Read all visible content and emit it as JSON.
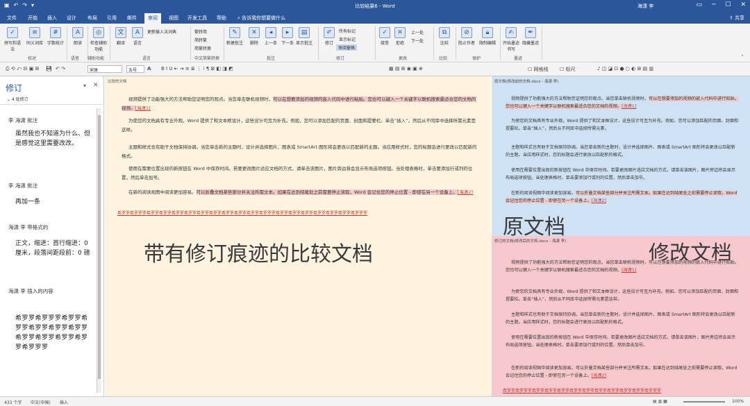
{
  "window": {
    "title": "比较结果6 - Word",
    "user": "海潇 李",
    "qa_icons": [
      "save-icon",
      "undo-icon",
      "redo-icon",
      "customize-icon"
    ]
  },
  "tabs": [
    "文件",
    "开始",
    "插入",
    "设计",
    "布局",
    "引用",
    "邮件",
    "审阅",
    "视图",
    "开发工具",
    "帮助"
  ],
  "active_tab": "审阅",
  "tell_me": "告诉我你想要做什么",
  "share": "共享",
  "ribbon": {
    "proof": [
      "拼写和语法",
      "同义词库",
      "字数统计"
    ],
    "proof_group": "校对",
    "speech": "朗读",
    "speech_group": "语音",
    "access": "检查辅助功能",
    "access_group": "辅助功能",
    "lang": [
      "翻译",
      "语言"
    ],
    "lang_group": "语言",
    "update_ime": "更新输入法词典",
    "chinese": [
      "繁转简",
      "简转繁",
      "简繁转换"
    ],
    "chinese_group": "中文简繁转换",
    "comments": [
      "新建批注",
      "删除",
      "上一条",
      "下一条",
      "显示批注"
    ],
    "comments_group": "批注",
    "track": [
      "修订",
      "所有标记",
      "显示标记",
      "审阅窗格"
    ],
    "track_group": "修订",
    "changes": [
      "接受",
      "拒绝",
      "上一处",
      "下一处"
    ],
    "changes_group": "更改",
    "compare": "比较",
    "compare_group": "比较",
    "protect": [
      "阻止作者",
      "限制编辑"
    ],
    "protect_group": "保护",
    "ink": [
      "开始墨迹书写",
      "隐藏墨迹"
    ],
    "ink_group": "墨迹"
  },
  "format_bar": {
    "font": "宋体",
    "size": "五号",
    "gridlines": "网格线",
    "ruler": "标尺"
  },
  "revisions_pane": {
    "title": "修订",
    "count": "4 处修订",
    "entries": [
      {
        "author": "李 海潇 批注",
        "body": "虽然我也不知道为什么、但是感觉这里需要改改。"
      },
      {
        "author": "李 海潇 批注",
        "body": "再加一条"
      },
      {
        "author": "海潇 李 带格式的",
        "body": "正文，缩进：首行缩进：0 厘米，段落间距段前：0 磅"
      },
      {
        "author": "海潇 李 插入的内容",
        "body": "希罗罗希罗罗罗希罗罗希罗罗希罗罗希罗罗希罗罗希罗罗希罗罗希罗罗希罗罗希罗罗罗"
      }
    ]
  },
  "compared_doc": {
    "label": "比较的文档",
    "p1a": "视频提供了功能强大的方法帮助您证明您的观点。当您单击联机视频时，",
    "p1b": "可以在想要添加的视频的嵌入代码中进行粘贴。您也可以键入一个关键字以联机搜索最适合您的文档的视频。",
    "p1tag": "[海潇1]",
    "p2": "为使您的文档具有专业外观，Word 提供了和文本框设计，这些设计可互为补充。例如，您可以添加匹配的页面、封面和提要栏。单击“插入”，然后从不同库中选择所需元素是这样。",
    "p3": "主题和样式也有助于文档保持协调。当您单击新的主题时，设计并选择图片、图表或 SmartArt 图形将会更改以匹配新的主题。当应用样式时，您的标题会进行更改以匹配新的格式。",
    "p4": "使用在需要位置出现的新按钮在 Word 中保存时间。若要更改图片适应文档的方式，请单击该图片，图片旁边将会显示布局选项按钮。当处理表格时，单击要添加行或列的位置，然后单击加号。",
    "p5a": "在新的阅读视图中阅读更加容易。",
    "p5b": "可以折叠文档某些部分并关注所需文本。如果在达到结尾处之前需要停止读取，Word 会记住您的停止位置 - 即使在另一个设备上。",
    "p5tag": "[海潇2]",
    "p6": "希罗罗希罗罗罗希罗罗希罗罗希罗罗希罗罗希罗罗希罗罗希罗罗希罗罗希罗罗希罗罗罗希罗罗希罗罗希罗罗希罗罗希罗罗希罗罗希罗罗罗",
    "overlay": "带有修订痕迹的比较文档"
  },
  "original_doc": {
    "label": "原文档(修改前的文档.docx - 海潇 李)",
    "p1a": "视频提供了功能强大的方法帮助您证明您的观点。当您单击联机视频时，",
    "p1b": "可以在想要添加的视频的嵌入代码中进行粘贴。您也可以键入一个关键字以联机搜索最适合您的文档的视频。",
    "p1tag": "[海潇1]",
    "p2": "为使您的文档具有专业外观，Word 提供了和文本框设计，这些设计可互为补充。例如，您可以添加匹配的页面、封面和提要栏。单击“插入”，然后从不同库中选择所需元素。",
    "p3": "主题和样式也有助于文档保持协调。当您单击新的主题时，设计并选择图片、图表或 SmartArt 图形将会更改以匹配新的主题。当应用样式时，您的标题会进行更改以匹配新的格式。",
    "p4": "使用在需要位置出现的新按钮在 Word 中保存时间。若要更改图片适应文档的方式，请单击该图片，图片旁边将会显示布局选项按钮。当处理表格时，单击要添加行或列的位置，然后单击加号。",
    "p5a": "在新的阅读视图中阅读更加容易。",
    "p5b": "可以折叠文档某些部分并关注所需文本。如果在达到结尾处之前需要停止读取，Word 会记住您的停止位置 - 即使在另一个设备上。",
    "p5tag": "[海潇2]",
    "overlay": "原文档"
  },
  "revised_doc": {
    "label": "修订的文档(修改后的文档.docx - 海潇 李)",
    "p1a": "视频提供了功能强大的方法帮助您证明您的观点。当您单击联机视频时，",
    "p1b": "可以在想要添加的视频的嵌入代码中进行粘贴。您也可以键入一个关键字以联机搜索最适合您的文档的视频。",
    "p1tag": "[海潇1]",
    "p2": "为使您的文档具有专业外观，Word 提供了和文本框设计，这些设计可互为补充。例如，您可以添加匹配的页面、封面和提要栏。单击“插入”，然后从不同库中选择所需元素是这样。",
    "p3": "主题和样式也有助于文档保持协调。当您单击新的主题时，设计并选择图片、图表或 SmartArt 图形将会更改以匹配新的主题。当应用样式时，您的标题会进行更改以匹配新的格式。",
    "p4": "使用在需要位置出现的新按钮在 Word 中保存时间。若要更改图片适应文档的方式，请单击该图片，图片旁边将会显示布局选项按钮。当处理表格时，单击要添加行或列的位置，然后单击加号。",
    "p5a": "在新的阅读视图中阅读更加容易。",
    "p5b": "可以折叠文档某些部分并关注所需文本。如果在达到结尾处之前需要停止读取，Word 会记住您的停止位置 - 即使在另一个设备上。",
    "p5tag": "[海潇2]",
    "p6": "希罗罗希罗罗罗希罗罗希罗罗希罗罗希罗罗希罗罗希罗罗希罗罗希罗罗希罗罗希罗罗罗",
    "overlay": "修改文档"
  },
  "status": {
    "words": "433 个字",
    "lang": "中文(中国)",
    "mode": "插入",
    "zoom": "100%"
  }
}
